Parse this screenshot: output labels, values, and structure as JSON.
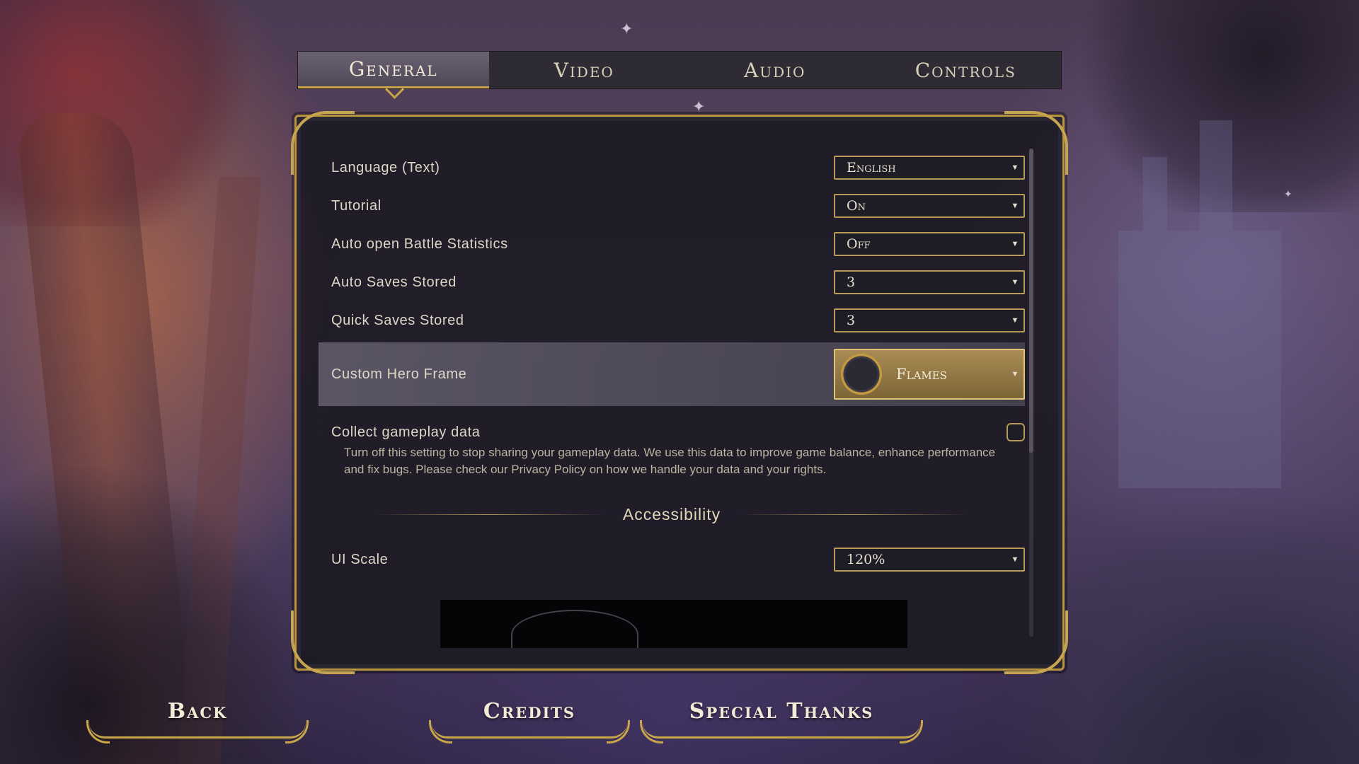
{
  "tabs": [
    {
      "label": "General",
      "active": true
    },
    {
      "label": "Video",
      "active": false
    },
    {
      "label": "Audio",
      "active": false
    },
    {
      "label": "Controls",
      "active": false
    }
  ],
  "settings": {
    "language": {
      "label": "Language (Text)",
      "value": "English"
    },
    "tutorial": {
      "label": "Tutorial",
      "value": "On"
    },
    "auto_battle_stats": {
      "label": "Auto open Battle Statistics",
      "value": "Off"
    },
    "auto_saves": {
      "label": "Auto Saves Stored",
      "value": "3"
    },
    "quick_saves": {
      "label": "Quick Saves Stored",
      "value": "3"
    },
    "hero_frame": {
      "label": "Custom Hero Frame",
      "value": "Flames"
    },
    "gameplay_data": {
      "label": "Collect gameplay data",
      "checked": false,
      "description": "Turn off this setting to stop sharing your gameplay data. We use this data to improve game balance, enhance performance and fix bugs. Please check our Privacy Policy on how we handle your data and your rights."
    },
    "accessibility_title": "Accessibility",
    "ui_scale": {
      "label": "UI Scale",
      "value": "120%"
    }
  },
  "bottom_buttons": {
    "back": "Back",
    "credits": "Credits",
    "special_thanks": "Special Thanks"
  },
  "icons": {
    "dropdown_caret": "caret-down-icon",
    "hero_frame_preview": "hero-frame-ring-icon"
  },
  "colors": {
    "accent_gold": "#c9a64a",
    "panel_bg": "#1c1a24",
    "highlight_row": "#6e6878"
  }
}
